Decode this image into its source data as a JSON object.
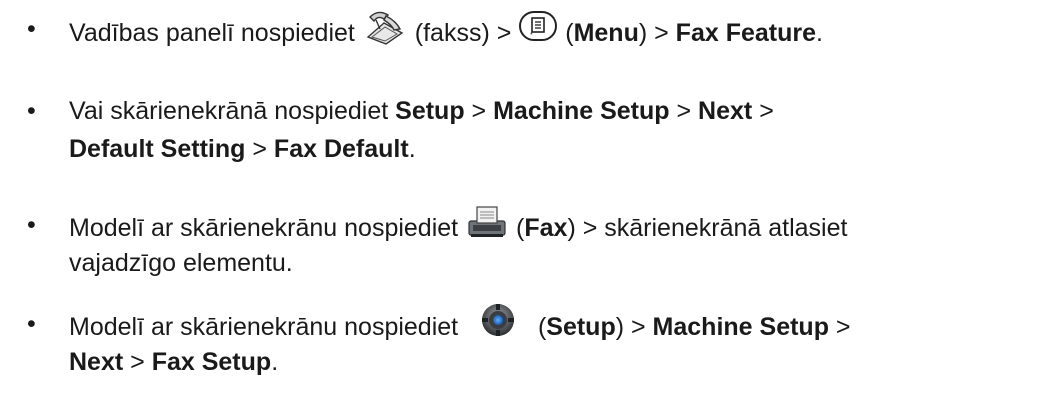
{
  "items": [
    {
      "l1_a": "Vadības panelī nospiediet",
      "icon_fax_label": "(fakss) >",
      "l1_b_open": "(",
      "menu": "Menu",
      "l1_b_close": ") >",
      "fax_feature": "Fax Feature",
      "period": "."
    },
    {
      "a": "Vai skārienekrānā nospiediet",
      "setup": "Setup",
      "sep1": ">",
      "machine_setup": "Machine Setup",
      "sep2": ">",
      "next": "Next",
      "sep3": ">",
      "default_setting": "Default Setting",
      "sep4": ">",
      "fax_default": "Fax Default",
      "period": "."
    },
    {
      "a": "Modelī ar skārienekrānu nospiediet",
      "open": "(",
      "fax": "Fax",
      "rest": ") > skārienekrānā atlasiet",
      "line2": "vajadzīgo elementu."
    },
    {
      "a": "Modelī ar skārienekrānu nospiediet",
      "open": "(",
      "setup": "Setup",
      "close": ") >",
      "machine_setup": "Machine Setup",
      "sep": ">",
      "next": "Next",
      "sep2": ">",
      "fax_setup": "Fax Setup",
      "period": "."
    }
  ],
  "bullet": "•",
  "icons": [
    "fax-handset-icon",
    "menu-button-icon",
    "fax-machine-icon",
    "settings-gear-icon"
  ]
}
